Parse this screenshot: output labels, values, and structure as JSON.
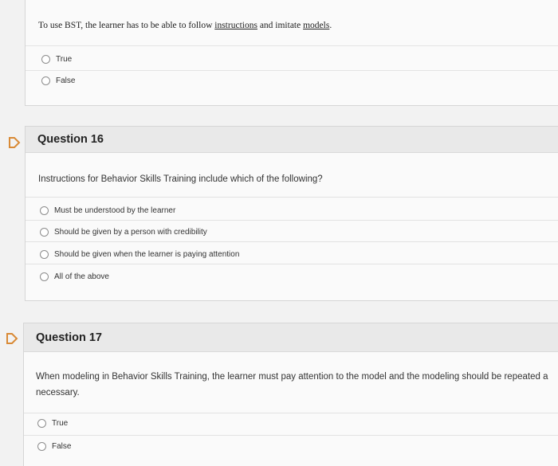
{
  "q15": {
    "prompt_start": "To use BST, the learner has to be able to follow ",
    "prompt_link1": "instructions",
    "prompt_mid": " and imitate ",
    "prompt_link2": "models",
    "prompt_end": ".",
    "choices": [
      "True",
      "False"
    ]
  },
  "q16": {
    "title": "Question 16",
    "prompt": "Instructions for Behavior Skills Training include which of the following?",
    "choices": [
      "Must be understood by the learner",
      "Should be given by a person with credibility",
      "Should be given when the learner is paying attention",
      "All of the above"
    ]
  },
  "q17": {
    "title": "Question 17",
    "prompt_line1": "When modeling in Behavior Skills Training, the learner must pay attention to the model and the modeling should be repeated a",
    "prompt_line2": "necessary.",
    "choices": [
      "True",
      "False"
    ]
  },
  "colors": {
    "flag": "#d98a36",
    "header_bg": "#e9e9e9",
    "panel_bg": "#fafafa"
  }
}
